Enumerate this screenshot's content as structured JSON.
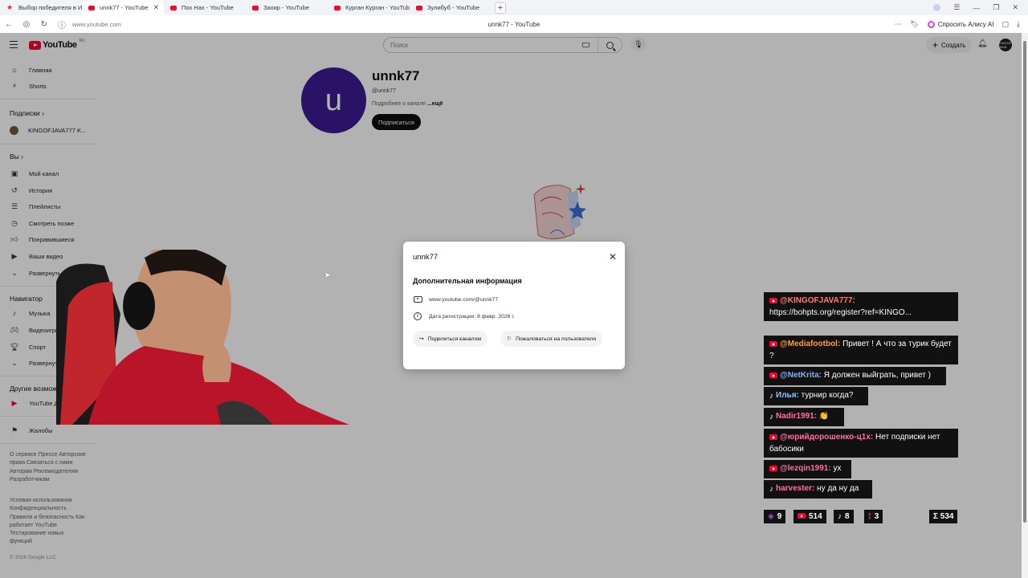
{
  "browser": {
    "tabs": [
      {
        "title": "Выбор победителя в Инс",
        "icon": "star-icon",
        "active": false
      },
      {
        "title": "unnk77 - YouTube",
        "icon": "youtube-icon",
        "active": true
      },
      {
        "title": "Пох Нах - YouTube",
        "icon": "youtube-icon",
        "active": false
      },
      {
        "title": "Захир - YouTube",
        "icon": "youtube-icon",
        "active": false
      },
      {
        "title": "Курган Курган - YouTube",
        "icon": "youtube-icon",
        "active": false
      },
      {
        "title": "Зулибуб - YouTube",
        "icon": "youtube-icon",
        "active": false
      }
    ],
    "url": "www.youtube.com",
    "page_title": "unnk77 - YouTube",
    "ask_alice": "Спросить Алису AI"
  },
  "youtube": {
    "logo_suffix": "RU",
    "search_placeholder": "Поиск",
    "create_label": "Создать",
    "avatar_text": "KINGOF JAVA",
    "sidebar": {
      "main": [
        {
          "label": "Главная",
          "icon": "home-icon"
        },
        {
          "label": "Shorts",
          "icon": "shorts-icon"
        }
      ],
      "subscriptions_header": "Подписки",
      "subscriptions": [
        {
          "label": "KINGOFJAVA777 K...",
          "icon": "channel-avatar"
        }
      ],
      "you_header": "Вы",
      "you": [
        {
          "label": "Мой канал",
          "icon": "my-channel-icon"
        },
        {
          "label": "История",
          "icon": "history-icon"
        },
        {
          "label": "Плейлисты",
          "icon": "playlists-icon"
        },
        {
          "label": "Смотреть позже",
          "icon": "watch-later-icon"
        },
        {
          "label": "Понравившиеся",
          "icon": "like-icon"
        },
        {
          "label": "Ваши видео",
          "icon": "your-videos-icon"
        },
        {
          "label": "Развернуть",
          "icon": "chevron-down-icon"
        }
      ],
      "navigator_header": "Навигатор",
      "navigator": [
        {
          "label": "Музыка",
          "icon": "music-icon"
        },
        {
          "label": "Видеоигры",
          "icon": "gaming-icon"
        },
        {
          "label": "Спорт",
          "icon": "sport-icon"
        },
        {
          "label": "Развернуть",
          "icon": "chevron-down-icon"
        }
      ],
      "other_header": "Другие возможности",
      "other": [
        {
          "label": "YouTube Детям",
          "icon": "youtube-kids-icon"
        }
      ],
      "report": {
        "label": "Жалобы",
        "icon": "flag-icon"
      },
      "footer_1": "О сервисе  Прессе  Авторские права  Связаться с нами  Авторам  Рекламодателям  Разработчикам",
      "footer_2": "Условия использования  Конфиденциальность  Правила и безопасность  Как работает YouTube  Тестирование новых функций",
      "copyright": "© 2026 Google LLC"
    },
    "channel": {
      "avatar_letter": "u",
      "name": "unnk77",
      "handle": "@unnk77",
      "more_text": "Подробнее о канале",
      "more_link": "...ещё",
      "subscribe": "Подписаться"
    },
    "dialog": {
      "title": "unnk77",
      "subtitle": "Дополнительная информация",
      "link": "www.youtube.com/@unnk77",
      "joined": "Дата регистрации: 8 февр. 2026 г.",
      "share": "Поделиться каналом",
      "report": "Пожаловаться на пользователя"
    }
  },
  "chat": {
    "messages": [
      {
        "platform": "youtube",
        "author": "@KINGOFJAVA777:",
        "text": "https://bohpts.org/register?ref=KINGO...",
        "color": "#ff7b7b"
      },
      {
        "platform": "youtube",
        "author": "@Mediafootbol:",
        "text": "Привет ! А что за турик будет ?",
        "color": "#ff9f43"
      },
      {
        "platform": "youtube",
        "author": "@NetKrita:",
        "text": "Я должен выйграть, привет )",
        "color": "#7fb2ff"
      },
      {
        "platform": "tiktok",
        "author": "Илья:",
        "text": "турнир когда?",
        "color": "#8ec5ff"
      },
      {
        "platform": "tiktok",
        "author": "Nadir1991:",
        "text": "👏",
        "color": "#ff6fa8"
      },
      {
        "platform": "youtube",
        "author": "@юрийдорошенко-ц1х:",
        "text": "Нет подписки нет бабосики",
        "color": "#ff6fa8"
      },
      {
        "platform": "youtube",
        "author": "@lezqin1991:",
        "text": "ух",
        "color": "#ff6fa8"
      },
      {
        "platform": "tiktok",
        "author": "harvester:",
        "text": "ну да ну да",
        "color": "#ff6fa8"
      }
    ],
    "stats": [
      {
        "icon": "twitch-icon",
        "value": "9"
      },
      {
        "icon": "youtube-icon",
        "value": "514"
      },
      {
        "icon": "tiktok-icon",
        "value": "8"
      },
      {
        "icon": "vk-icon",
        "value": "3"
      }
    ],
    "total": "Σ 534"
  }
}
